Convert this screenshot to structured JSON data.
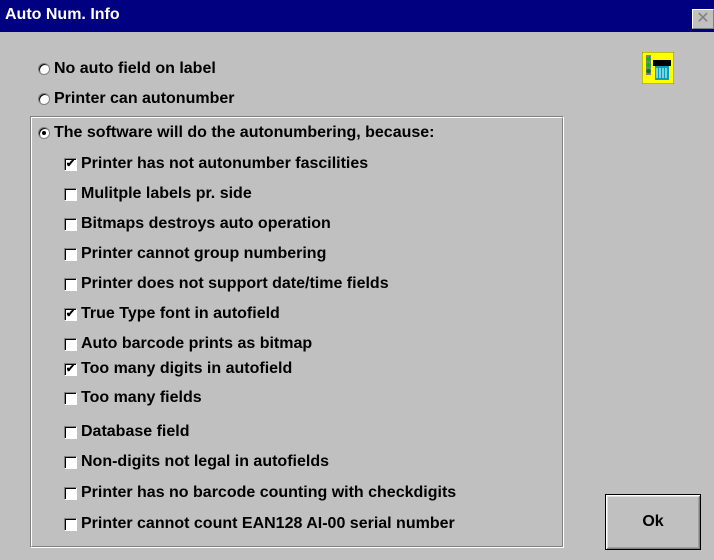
{
  "window": {
    "title": "Auto Num. Info",
    "close_glyph": "✕"
  },
  "options": [
    {
      "label": "No auto field on label",
      "checked": false
    },
    {
      "label": "Printer can autonumber",
      "checked": false
    },
    {
      "label": "The software will do the autonumbering, because:",
      "checked": true
    }
  ],
  "reasons": [
    {
      "label": "Printer has not autonumber fascilities",
      "checked": true
    },
    {
      "label": "Mulitple labels pr. side",
      "checked": false
    },
    {
      "label": "Bitmaps destroys auto operation",
      "checked": false
    },
    {
      "label": "Printer cannot group numbering",
      "checked": false
    },
    {
      "label": "Printer does not support date/time fields",
      "checked": false
    },
    {
      "label": "True Type font in autofield",
      "checked": true
    },
    {
      "label": "Auto barcode prints as bitmap",
      "checked": false
    },
    {
      "label": "Too many digits in autofield",
      "checked": true
    },
    {
      "label": "Too many fields",
      "checked": false
    },
    {
      "label": "Database field",
      "checked": false
    },
    {
      "label": "Non-digits not legal in autofields",
      "checked": false
    },
    {
      "label": "Printer has no barcode counting with checkdigits",
      "checked": false
    },
    {
      "label": "Printer cannot count EAN128 AI-00 serial number",
      "checked": false
    }
  ],
  "ok_label": "Ok",
  "check_glyph": "✔",
  "icon": "printer-icon",
  "colors": {
    "titlebar": "#000080",
    "face": "#c0c0c0",
    "icon_bg": "#ffff00",
    "icon_led": "#00c000"
  }
}
